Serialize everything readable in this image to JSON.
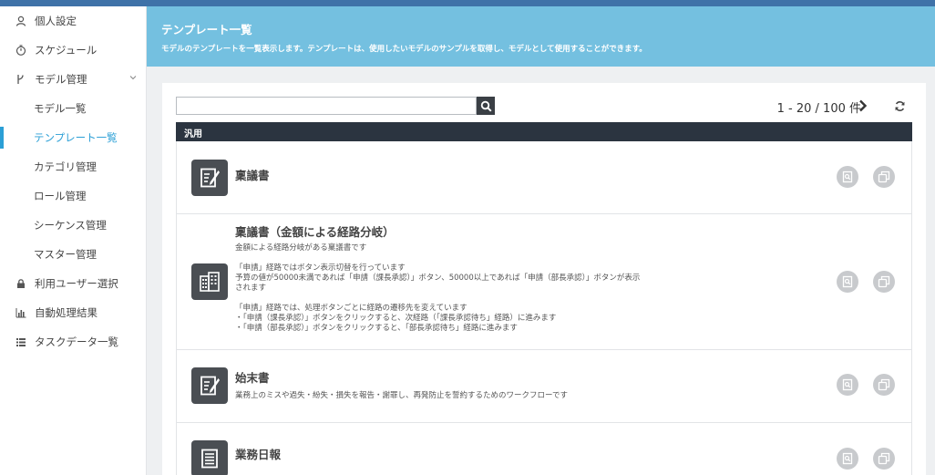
{
  "sidebar": {
    "items": [
      {
        "label": "個人設定",
        "icon": "user-icon"
      },
      {
        "label": "スケジュール",
        "icon": "timer-icon"
      },
      {
        "label": "モデル管理",
        "icon": "branch-icon"
      },
      {
        "label": "モデル一覧"
      },
      {
        "label": "テンプレート一覧"
      },
      {
        "label": "カテゴリ管理"
      },
      {
        "label": "ロール管理"
      },
      {
        "label": "シーケンス管理"
      },
      {
        "label": "マスター管理"
      },
      {
        "label": "利用ユーザー選択",
        "icon": "lock-icon"
      },
      {
        "label": "自動処理結果",
        "icon": "bar-chart-icon"
      },
      {
        "label": "タスクデータ一覧",
        "icon": "list-icon"
      }
    ]
  },
  "header": {
    "title": "テンプレート一覧",
    "description": "モデルのテンプレートを一覧表示します。テンプレートは、使用したいモデルのサンプルを取得し、モデルとして使用することができます。"
  },
  "search": {
    "value": "",
    "placeholder": ""
  },
  "pagination": {
    "text": "1 - 20 / 100 件"
  },
  "section": {
    "label": "汎用"
  },
  "templates": [
    {
      "title": "稟議書",
      "description": "",
      "icon": "document-pen-icon"
    },
    {
      "title": "稟議書（金額による経路分岐）",
      "description": "金額による経路分岐がある稟議書です\n\n「申請」経路ではボタン表示切替を行っています\n予算の値が50000未満であれば「申請（課長承認）」ボタン、50000以上であれば「申請（部長承認）」ボタンが表示\nされます\n\n「申請」経路では、処理ボタンごとに経路の遷移先を変えています\n・「申請（課長承認）」ボタンをクリックすると、次経路（「課長承認待ち」経路）に進みます\n・「申請（部長承認）」ボタンをクリックすると、「部長承認待ち」経路に進みます",
      "icon": "building-icon"
    },
    {
      "title": "始末書",
      "description": "業務上のミスや過失・紛失・損失を報告・謝罪し、再発防止を誓約するためのワークフローです",
      "icon": "document-pen-icon"
    },
    {
      "title": "業務日報",
      "description": "",
      "icon": "document-lines-icon"
    }
  ],
  "colors": {
    "accent": "#2b9fd6",
    "header_bg": "#74c0e0",
    "section_bg": "#2b3440",
    "topbar": "#3f72a8"
  }
}
